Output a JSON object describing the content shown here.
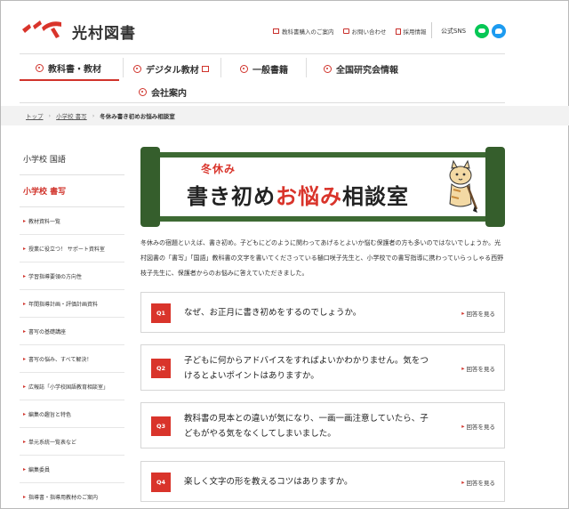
{
  "header": {
    "company": "光村図書",
    "util_links": [
      "教科書購入のご案内",
      "お問い合わせ",
      "採用情報"
    ],
    "sns_label": "公式SNS"
  },
  "gnav": {
    "items": [
      "教科書・教材",
      "デジタル教材",
      "一般書籍",
      "全国研究会情報",
      "会社案内"
    ]
  },
  "breadcrumb": {
    "items": [
      "トップ",
      "小学校 書写"
    ],
    "current": "冬休み書き初めお悩み相談室"
  },
  "sidebar": {
    "heading1": "小学校 国語",
    "heading2": "小学校 書写",
    "items": [
      "教材資料一覧",
      "授業に役立つ！ サポート資料室",
      "学習指導要領の方向性",
      "年間指導計画・評価計画資料",
      "書写の基礎講座",
      "書写の悩み、すべて解決！",
      "広報誌「小学校国語教育相談室」",
      "編集の趣旨と特色",
      "単元系統一覧表など",
      "編集委員",
      "指導書・指導用教材のご案内"
    ]
  },
  "banner": {
    "sub": "冬休み",
    "title_a": "書き初め",
    "title_b": "お悩み",
    "title_c": "相談室"
  },
  "intro": {
    "text": "冬休みの宿題といえば、書き初め。子どもにどのように関わってあげるとよいか悩む保護者の方も多いのではないでしょうか。光村図書の「書写」「国語」教科書の文字を書いてくださっている樋口咲子先生と、小学校での書写指導に携わっていらっしゃる西野枝子先生に、保護者からのお悩みに答えていただきました。"
  },
  "qa": [
    {
      "badge": "Q1",
      "text": "なぜ、お正月に書き初めをするのでしょうか。",
      "more": "回答を見る"
    },
    {
      "badge": "Q2",
      "text": "子どもに何からアドバイスをすればよいかわかりません。気をつけるとよいポイントはありますか。",
      "more": "回答を見る"
    },
    {
      "badge": "Q3",
      "text": "教科書の見本との違いが気になり、一画一画注意していたら、子どもがやる気をなくしてしまいました。",
      "more": "回答を見る"
    },
    {
      "badge": "Q4",
      "text": "楽しく文字の形を教えるコツはありますか。",
      "more": "回答を見る"
    }
  ],
  "colors": {
    "accent": "#d0332b",
    "banner_green": "#3d6a33",
    "breadcrumb_bg": "#f2f2f2"
  }
}
